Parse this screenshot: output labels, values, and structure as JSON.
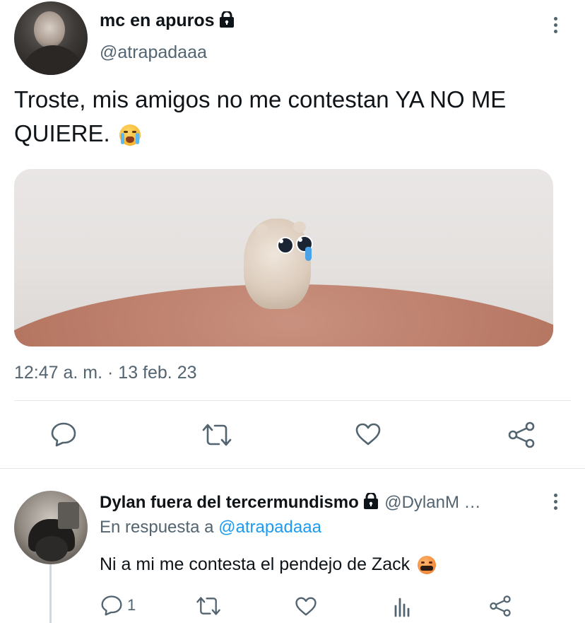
{
  "tweet": {
    "author_name": "mc en apuros",
    "author_handle": "@atrapadaaa",
    "text": "Troste, mis amigos no me contestan YA NO ME QUIERE.",
    "timestamp": "12:47 a. m. · 13 feb. 23",
    "icons": {
      "lock": "lock-icon",
      "more": "more-options-icon",
      "emoji": "loudly-crying-face-emoji",
      "reply": "reply-icon",
      "retweet": "retweet-icon",
      "like": "heart-icon",
      "share": "share-icon"
    }
  },
  "reply": {
    "author_name": "Dylan fuera del tercermundismo",
    "author_handle": "@DylanM …",
    "replying_prefix": "En respuesta a",
    "replying_to": "@atrapadaaa",
    "text": "Ni a mi me contesta el pendejo de Zack",
    "reply_count": "1",
    "icons": {
      "lock": "lock-icon",
      "more": "more-options-icon",
      "emoji": "face-with-symbols-on-mouth-emoji",
      "reply": "reply-icon",
      "retweet": "retweet-icon",
      "like": "heart-icon",
      "views": "analytics-icon",
      "share": "share-icon"
    }
  },
  "colors": {
    "text": "#0f1419",
    "secondary": "#536471",
    "link": "#1d9bf0",
    "divider": "#e4e8eb"
  }
}
